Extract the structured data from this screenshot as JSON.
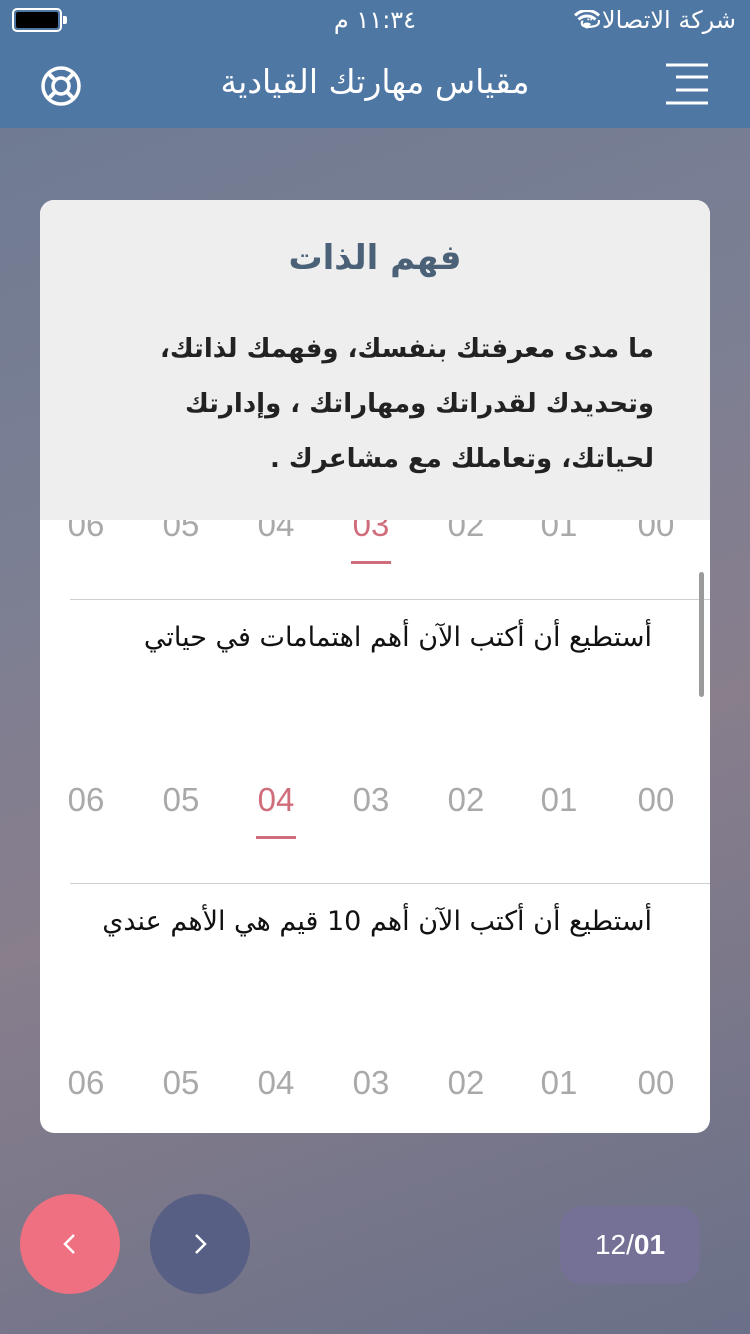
{
  "status_bar": {
    "time": "١١:٣٤ م",
    "carrier": "شركة الاتصالات"
  },
  "nav": {
    "title": "مقياس مهارتك القيادية"
  },
  "card": {
    "title": "فهم الذات",
    "description": "ما مدى معرفتك بنفسك، وفهمك لذاتك، وتحديدك لقدراتك ومهاراتك ، وإدارتك لحياتك، وتعاملك مع مشاعرك ."
  },
  "rating_options": [
    "06",
    "05",
    "04",
    "03",
    "02",
    "01",
    "00"
  ],
  "rows": [
    {
      "selected": "03"
    },
    {
      "question": "أستطيع أن أكتب الآن أهم اهتمامات في حياتي",
      "selected": "04"
    },
    {
      "question": "أستطيع أن أكتب الآن أهم 10 قيم هي الأهم عندي",
      "selected": null
    }
  ],
  "footer": {
    "counter_total": "12/",
    "counter_current": "01"
  },
  "colors": {
    "header_blue": "#4f77a4",
    "selected_pink": "#d06d7b",
    "prev_button": "#ef7080",
    "next_button": "#575f84",
    "counter_bg": "#757096"
  },
  "icons": [
    "battery-icon",
    "wifi-icon",
    "help-lifebuoy-icon",
    "menu-icon",
    "chevron-left-icon",
    "chevron-right-icon"
  ]
}
